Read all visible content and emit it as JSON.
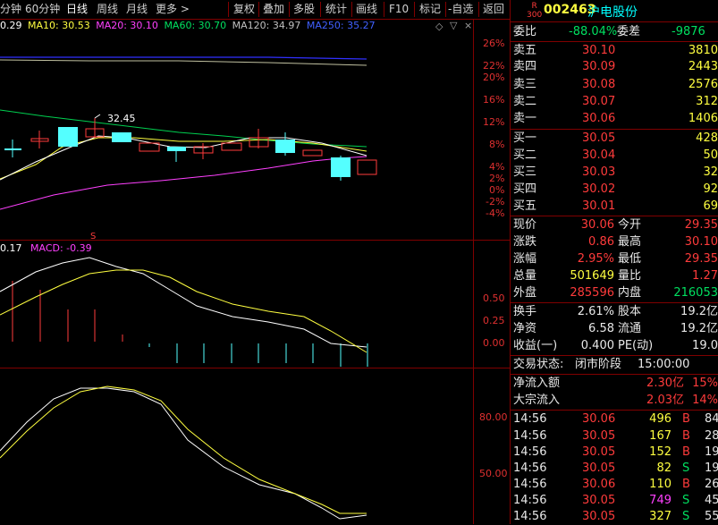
{
  "colors": {
    "up": "#ff3b3b",
    "down": "#54ffff",
    "ma5": "#ffffff",
    "ma10": "#ffff40",
    "ma20": "#ff40ff",
    "ma60": "#00e060",
    "ma120": "#c0c0c0",
    "ma250": "#4040ff"
  },
  "toolbar": {
    "items": [
      "分钟",
      "60分钟",
      "日线",
      "周线",
      "月线",
      "更多 >",
      "复权",
      "叠加",
      "多股",
      "统计",
      "画线",
      "F10",
      "标记",
      "-自选",
      "返回"
    ],
    "selected": "日线"
  },
  "ma_legend": {
    "ma5": "0.29",
    "ma10": "MA10: 30.53",
    "ma20": "MA20: 30.10",
    "ma60": "MA60: 30.70",
    "ma120": "MA120: 34.97",
    "ma250": "MA250: 35.27"
  },
  "price_axis": [
    "26%",
    "22%",
    "20%",
    "16%",
    "12%",
    "8%",
    "4%",
    "2%",
    "0%",
    "-2%",
    "-4%"
  ],
  "peak_label": "32.45",
  "marker_s": "S",
  "macd_legend": {
    "a": "0.17",
    "b": "MACD: -0.39"
  },
  "macd_axis": [
    "0.50",
    "0.25",
    "0.00"
  ],
  "kdj_axis": [
    "80.00",
    "50.00"
  ],
  "stock": {
    "badge_top": "R",
    "badge_bottom": "300",
    "code": "002463",
    "name": "沪电股份"
  },
  "weibi": {
    "label1": "委比",
    "val1": "-88.04%",
    "label2": "委差",
    "val2": "-9876"
  },
  "asks": [
    {
      "label": "卖五",
      "price": "30.10",
      "vol": "3810"
    },
    {
      "label": "卖四",
      "price": "30.09",
      "vol": "2443"
    },
    {
      "label": "卖三",
      "price": "30.08",
      "vol": "2576"
    },
    {
      "label": "卖二",
      "price": "30.07",
      "vol": "312"
    },
    {
      "label": "卖一",
      "price": "30.06",
      "vol": "1406"
    }
  ],
  "bids": [
    {
      "label": "买一",
      "price": "30.05",
      "vol": "428"
    },
    {
      "label": "买二",
      "price": "30.04",
      "vol": "50"
    },
    {
      "label": "买三",
      "price": "30.03",
      "vol": "32"
    },
    {
      "label": "买四",
      "price": "30.02",
      "vol": "92"
    },
    {
      "label": "买五",
      "price": "30.01",
      "vol": "69"
    }
  ],
  "quote": [
    {
      "l1": "现价",
      "v1": "30.06",
      "l2": "今开",
      "v2": "29.35"
    },
    {
      "l1": "涨跌",
      "v1": "0.86",
      "l2": "最高",
      "v2": "30.10"
    },
    {
      "l1": "涨幅",
      "v1": "2.95%",
      "l2": "最低",
      "v2": "29.35"
    },
    {
      "l1": "总量",
      "v1": "501649",
      "l2": "量比",
      "v2": "1.27"
    },
    {
      "l1": "外盘",
      "v1": "285596",
      "l2": "内盘",
      "v2": "216053"
    }
  ],
  "fund": [
    {
      "l1": "换手",
      "v1": "2.61%",
      "l2": "股本",
      "v2": "19.2亿"
    },
    {
      "l1": "净资",
      "v1": "6.58",
      "l2": "流通",
      "v2": "19.2亿"
    },
    {
      "l1": "收益(一)",
      "v1": "0.400",
      "l2": "PE(动)",
      "v2": "19.0"
    }
  ],
  "trade_status": {
    "label": "交易状态:",
    "value": "闭市阶段",
    "time": "15:00:00"
  },
  "flow": [
    {
      "label": "净流入额",
      "val": "2.30亿",
      "pct": "15%"
    },
    {
      "label": "大宗流入",
      "val": "2.03亿",
      "pct": "14%"
    }
  ],
  "ticks": [
    {
      "time": "14:56",
      "price": "30.06",
      "vol": "496",
      "side": "B",
      "num": "84"
    },
    {
      "time": "14:56",
      "price": "30.05",
      "vol": "167",
      "side": "B",
      "num": "28"
    },
    {
      "time": "14:56",
      "price": "30.05",
      "vol": "152",
      "side": "B",
      "num": "19"
    },
    {
      "time": "14:56",
      "price": "30.05",
      "vol": "82",
      "side": "S",
      "num": "19"
    },
    {
      "time": "14:56",
      "price": "30.06",
      "vol": "110",
      "side": "B",
      "num": "26"
    },
    {
      "time": "14:56",
      "price": "30.05",
      "vol": "749",
      "side": "S",
      "num": "45"
    },
    {
      "time": "14:56",
      "price": "30.05",
      "vol": "327",
      "side": "S",
      "num": "55"
    }
  ]
}
